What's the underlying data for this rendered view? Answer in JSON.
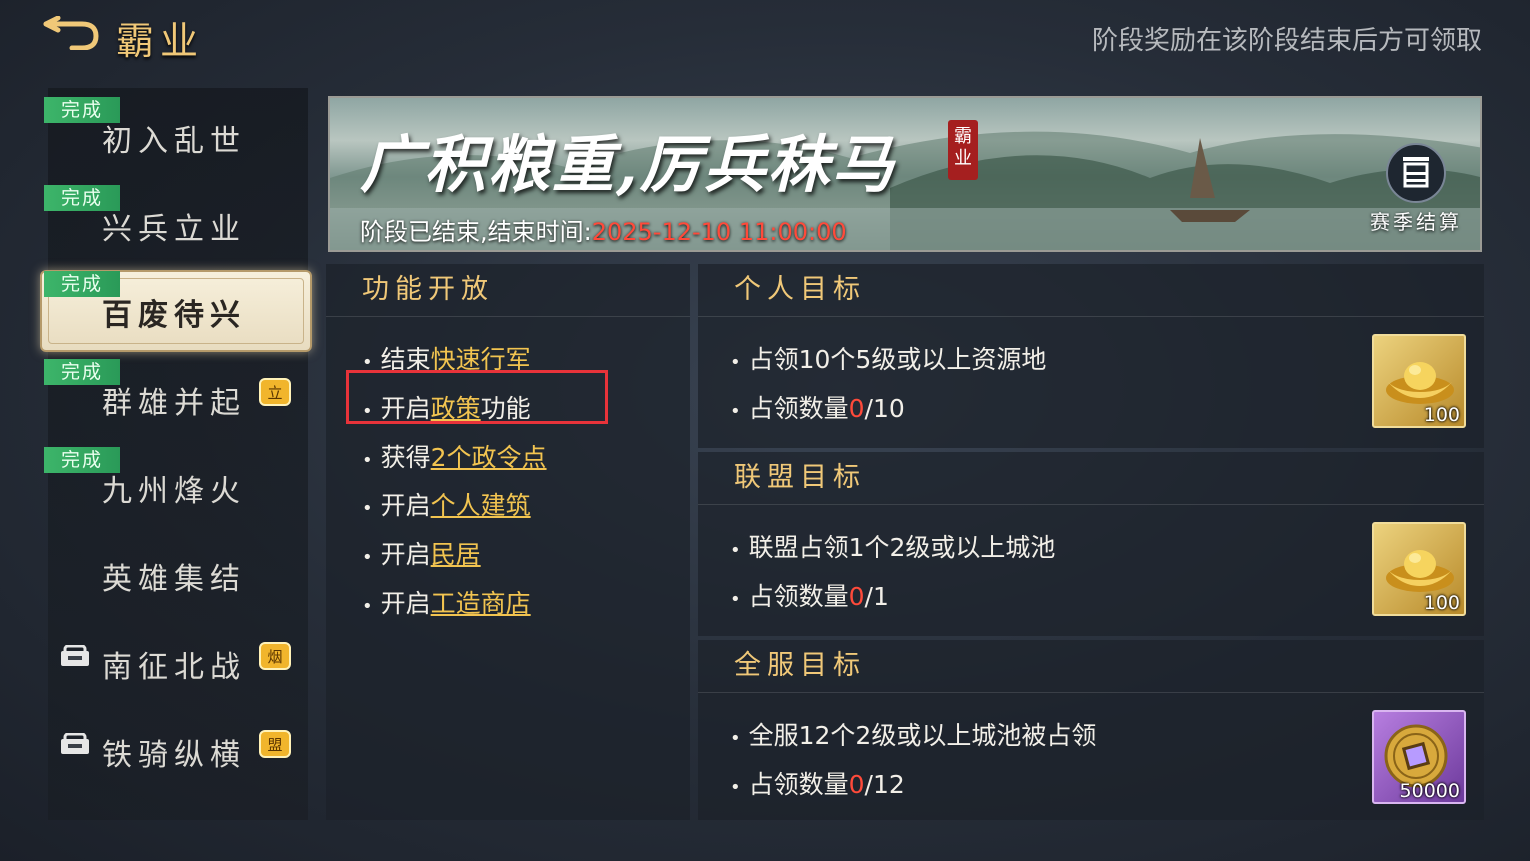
{
  "header": {
    "title": "霸业",
    "hint": "阶段奖励在该阶段结束后方可领取"
  },
  "sidebar": {
    "stages": [
      {
        "name": "初入乱世",
        "badge": "完成"
      },
      {
        "name": "兴兵立业",
        "badge": "完成"
      },
      {
        "name": "百废待兴",
        "badge": "完成",
        "selected": true
      },
      {
        "name": "群雄并起",
        "badge": "完成",
        "tag": "立"
      },
      {
        "name": "九州烽火",
        "badge": "完成"
      },
      {
        "name": "英雄集结"
      },
      {
        "name": "南征北战",
        "locked": true,
        "tag": "烟"
      },
      {
        "name": "铁骑纵横",
        "locked": true,
        "tag": "盟"
      }
    ]
  },
  "banner": {
    "title": "广积粮重,厉兵秣马",
    "seal": "霸业",
    "status_label": "阶段已结束,结束时间:",
    "end_time": "2025-12-10 11:00:00",
    "season_button": "赛季结算"
  },
  "functions": {
    "header": "功能开放",
    "items": [
      {
        "prefix": "结束",
        "link": "快速行军",
        "suffix": ""
      },
      {
        "prefix": "开启",
        "link": "政策",
        "suffix": "功能"
      },
      {
        "prefix": "获得",
        "link": "2个政令点",
        "suffix": ""
      },
      {
        "prefix": "开启",
        "link": "个人建筑",
        "suffix": ""
      },
      {
        "prefix": "开启",
        "link": "民居",
        "suffix": ""
      },
      {
        "prefix": "开启",
        "link": "工造商店",
        "suffix": ""
      }
    ]
  },
  "objectives": [
    {
      "header": "个人目标",
      "line1": "占领10个5级或以上资源地",
      "progress_label": "占领数量",
      "current": "0",
      "total": "/10",
      "reward": {
        "icon": "gold-ingot-icon",
        "count": "100"
      }
    },
    {
      "header": "联盟目标",
      "line1": "联盟占领1个2级或以上城池",
      "progress_label": "占领数量",
      "current": "0",
      "total": "/1",
      "reward": {
        "icon": "gold-ingot-icon",
        "count": "100"
      }
    },
    {
      "header": "全服目标",
      "line1": "全服12个2级或以上城池被占领",
      "progress_label": "占领数量",
      "current": "0",
      "total": "/12",
      "reward": {
        "icon": "copper-coin-icon",
        "count": "50000"
      }
    }
  ],
  "colors": {
    "accent_gold": "#f0c878",
    "link": "#f2c450",
    "complete_badge": "#3db56a",
    "alert_red": "#ff4a3a",
    "highlight_frame": "#e8333a"
  }
}
